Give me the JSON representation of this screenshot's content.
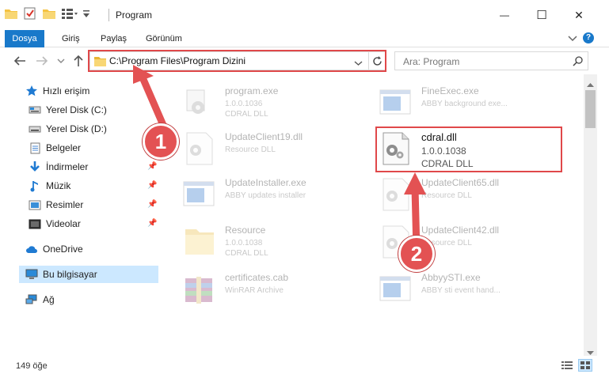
{
  "window": {
    "title": "Program",
    "controls": {
      "minimize": "—",
      "maximize": "☐",
      "close": "✕"
    }
  },
  "ribbon": {
    "tabs": [
      {
        "label": "Dosya"
      },
      {
        "label": "Giriş"
      },
      {
        "label": "Paylaş"
      },
      {
        "label": "Görünüm"
      }
    ],
    "help": "?"
  },
  "address": {
    "path": "C:\\Program Files\\Program Dizini",
    "search_placeholder": "Ara: Program"
  },
  "nav": {
    "items": [
      {
        "label": "Hızlı erişim",
        "icon": "star-icon"
      },
      {
        "label": "Yerel Disk (C:)",
        "icon": "drive-icon"
      },
      {
        "label": "Yerel Disk (D:)",
        "icon": "drive-icon"
      },
      {
        "label": "Belgeler",
        "icon": "documents-icon"
      },
      {
        "label": "İndirmeler",
        "icon": "download-icon"
      },
      {
        "label": "Müzik",
        "icon": "music-icon"
      },
      {
        "label": "Resimler",
        "icon": "pictures-icon"
      },
      {
        "label": "Videolar",
        "icon": "videos-icon"
      },
      {
        "label": "OneDrive",
        "icon": "cloud-icon"
      },
      {
        "label": "Bu bilgisayar",
        "icon": "computer-icon"
      },
      {
        "label": "Ağ",
        "icon": "network-icon"
      }
    ]
  },
  "files": [
    {
      "name": "program.exe",
      "line1": "1.0.0.1036",
      "line2": "CDRAL DLL",
      "icon": "exe-icon"
    },
    {
      "name": "FineExec.exe",
      "line1": "ABBY background exe...",
      "line2": "",
      "icon": "window-icon"
    },
    {
      "name": "UpdateClient19.dll",
      "line1": "Resource DLL",
      "line2": "",
      "icon": "dll-gear-icon"
    },
    {
      "name": "cdral.dll",
      "line1": "1.0.0.1038",
      "line2": "CDRAL DLL",
      "icon": "dll-gear-icon"
    },
    {
      "name": "UpdateInstaller.exe",
      "line1": "ABBY updates installer",
      "line2": "",
      "icon": "window-icon"
    },
    {
      "name": "UpdateClient65.dll",
      "line1": "Resource DLL",
      "line2": "",
      "icon": "dll-gear-icon"
    },
    {
      "name": "Resource",
      "line1": "1.0.0.1038",
      "line2": "CDRAL DLL",
      "icon": "folder-icon"
    },
    {
      "name": "UpdateClient42.dll",
      "line1": "Resource DLL",
      "line2": "",
      "icon": "dll-gear-icon"
    },
    {
      "name": "certificates.cab",
      "line1": "WinRAR Archive",
      "line2": "",
      "icon": "archive-icon"
    },
    {
      "name": "AbbyySTI.exe",
      "line1": "ABBY sti event hand...",
      "line2": "",
      "icon": "window-icon"
    }
  ],
  "status": {
    "count": "149 öğe"
  },
  "callouts": [
    "1",
    "2"
  ],
  "colors": {
    "accent": "#1979ca",
    "highlight": "#e0484a",
    "badge": "#e35253"
  }
}
